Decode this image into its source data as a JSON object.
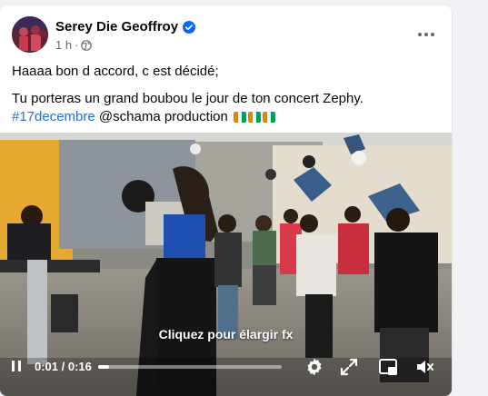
{
  "post": {
    "author": "Serey Die Geoffroy",
    "time": "1 h",
    "separator": "·",
    "line1": "Haaaa bon d accord, c est décidé;",
    "line2": "Tu porteras un grand boubou le jour de ton concert Zephy.",
    "hashtag": "#17decembre",
    "mention": "@schama production",
    "flags_count": 3
  },
  "video": {
    "caption": "Cliquez pour élargir fx",
    "time_display": "0:01 / 0:16",
    "progress": 0.06
  },
  "colors": {
    "link": "#216fdb",
    "verified": "#0866ff",
    "flag": [
      "#f77f00",
      "#ffffff",
      "#009e60"
    ]
  },
  "icons": [
    "avatar",
    "verified-icon",
    "globe-icon",
    "more-icon",
    "play-pause-icon",
    "settings-icon",
    "expand-icon",
    "pip-icon",
    "volume-icon"
  ]
}
